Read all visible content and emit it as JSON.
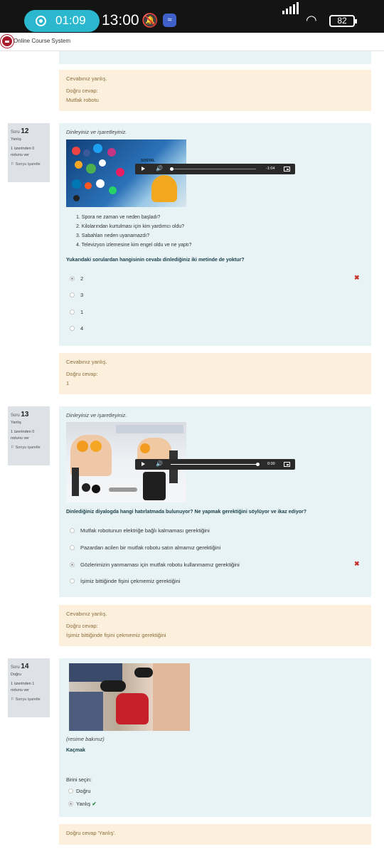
{
  "status_bar": {
    "timer": "01:09",
    "clock": "13:00",
    "battery": "82"
  },
  "navbar": {
    "site_name": "Online Course System"
  },
  "q11_feedback": {
    "result": "Cevabınız yanlış.",
    "correct_label": "Doğru cevap:",
    "correct_answer": "Mutfak robotu"
  },
  "q12": {
    "info": {
      "prefix": "Soru",
      "number": "12",
      "state": "Yanlış",
      "score": "1 üzerinden 0 notunu ver",
      "flag": "Sorıyu işaretle"
    },
    "instruction": "Dinleyiniz ve işaretleyiniz.",
    "image_caption": "SOSYAL",
    "player_time": "-1:04",
    "questions": [
      "1. Spora ne zaman ve neden başladı?",
      "2. Kilolarından kurtulması için kim yardımcı oldu?",
      "3. Sabahları neden uyanamazdı?",
      "4. Televizyon izlemesine kim engel oldu ve ne yaptı?"
    ],
    "prompt": "Yukarıdaki sorulardan hangisinin cevabı dinlediğiniz iki metinde de yoktur?",
    "options": [
      "2",
      "3",
      "1",
      "4"
    ],
    "selected_index": 0
  },
  "q12_feedback": {
    "result": "Cevabınız yanlış.",
    "correct_label": "Doğru cevap:",
    "correct_answer": "1"
  },
  "q13": {
    "info": {
      "prefix": "Soru",
      "number": "13",
      "state": "Yanlış",
      "score": "1 üzerinden 0 notunu ver",
      "flag": "Sorıyu işaretle"
    },
    "instruction": "Dinleyiniz ve işaretleyiniz.",
    "player_time": "0:00",
    "prompt": "Dinlediğiniz diyalogda hangi hatırlatmada bulunuyor? Ne yapmak gerektiğini söylüyor ve ikaz ediyor?",
    "options": [
      "Mutfak robotunun elektriğe bağlı kalmaması gerektiğini",
      "Pazardan acilen bir mutfak robotu satın almamız gerektiğini",
      "Gözlerimizin yanmaması için mutfak robotu kullanmamız gerektiğini",
      "İşimiz bittiğinde fişini çekmemiz gerektiğini"
    ],
    "selected_index": 2
  },
  "q13_feedback": {
    "result": "Cevabınız yanlış.",
    "correct_label": "Doğru cevap:",
    "correct_answer": "İşimiz bittiğinde fişini çekmemiz gerektiğini"
  },
  "q14": {
    "info": {
      "prefix": "Soru",
      "number": "14",
      "state": "Doğru",
      "score": "1 üzerinden 1 notunu ver",
      "flag": "Sorıyu işaretle"
    },
    "instruction": "(resime bakınız)",
    "prompt": "Kaçmak",
    "choose_label": "Birini seçin:",
    "options": [
      "Doğru",
      "Yanlış"
    ],
    "selected_index": 1
  },
  "q14_feedback": {
    "correct_text": "Doğru cevap 'Yanlış'."
  },
  "colors": {
    "question_bg": "#e7f3f5",
    "feedback_bg": "#fcefdc",
    "info_bg": "#dee2e6",
    "incorrect": "#c9302c",
    "correct": "#2e8a3e",
    "timer_pill": "#2bb8cf"
  }
}
